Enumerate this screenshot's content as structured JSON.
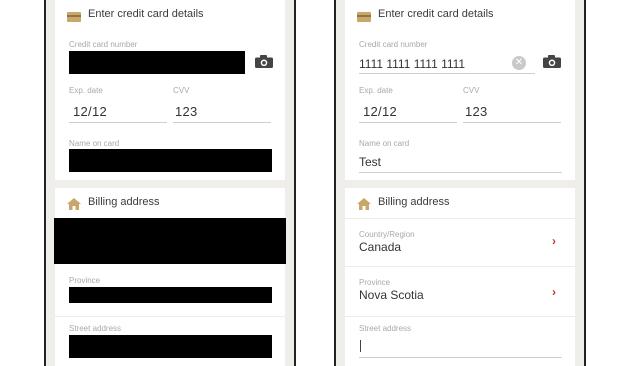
{
  "credit_card_section": {
    "title": "Enter credit card details",
    "card_number_label": "Credit card number",
    "exp_label": "Exp. date",
    "cvv_label": "CVV",
    "name_label": "Name on card"
  },
  "billing_section": {
    "title": "Billing address",
    "country_label": "Country/Region",
    "province_label": "Province",
    "street_label": "Street address"
  },
  "left_screen": {
    "exp_value": "12/12",
    "cvv_value": "123"
  },
  "right_screen": {
    "card_number_value": "1111 1111 1111 1111",
    "exp_value": "12/12",
    "cvv_value": "123",
    "name_value": "Test",
    "country_value": "Canada",
    "province_value": "Nova Scotia",
    "street_value": ""
  },
  "icons": {
    "card": "credit-card-icon",
    "home": "home-icon",
    "camera": "camera-icon",
    "clear": "clear-icon",
    "chevron": "chevron-right-icon"
  },
  "colors": {
    "accent": "#c8a86a",
    "chevron": "#c0392b",
    "redaction": "#000000"
  }
}
